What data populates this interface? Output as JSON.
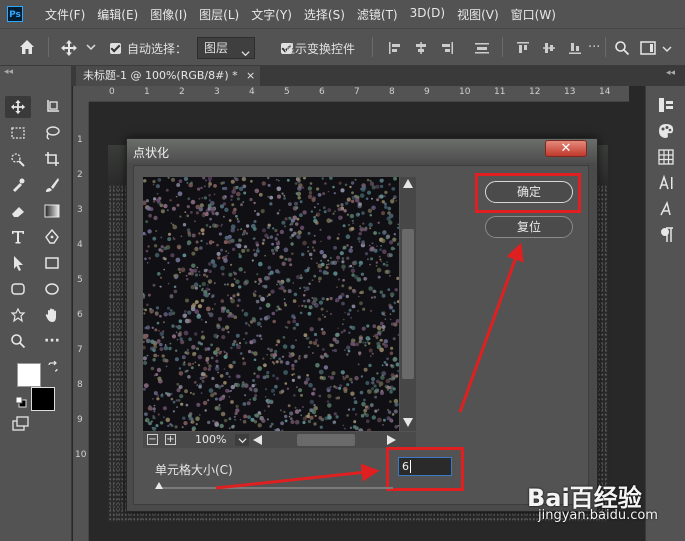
{
  "app": {
    "logo": "Ps"
  },
  "menu": [
    "文件(F)",
    "编辑(E)",
    "图像(I)",
    "图层(L)",
    "文字(Y)",
    "选择(S)",
    "滤镜(T)",
    "3D(D)",
    "视图(V)",
    "窗口(W)"
  ],
  "options_bar": {
    "auto_select_label": "自动选择：",
    "auto_select_value": "图层",
    "show_transform_label": "显示变换控件",
    "auto_select_checked": true,
    "show_transform_checked": true
  },
  "document_tab": {
    "title": "未标题-1 @ 100%(RGB/8#) *",
    "close": "×"
  },
  "panel_collapse": "◂◂",
  "rulers": {
    "top": [
      "0",
      "1",
      "2",
      "3",
      "4",
      "5",
      "6",
      "7",
      "8",
      "9",
      "10",
      "11",
      "12",
      "13",
      "14"
    ],
    "left": [
      "1",
      "2",
      "3",
      "4",
      "5",
      "6",
      "7",
      "8",
      "9",
      "10"
    ]
  },
  "dialog": {
    "title": "点状化",
    "close_label": "✕",
    "ok_label": "确定",
    "reset_label": "复位",
    "zoom_value": "100%",
    "cell_size_label": "单元格大小(C)",
    "cell_size_value": "6",
    "zoom_out": "−",
    "zoom_in": "+",
    "slider_level_fraction": 0.0
  },
  "watermark": {
    "logo": "Bai百经验",
    "url": "jingyan.baidu.com"
  },
  "colors": {
    "accent_red": "#e02020",
    "panel_bg": "#535353",
    "dialog_bg": "#4a4a4a",
    "input_border": "#3a78c8",
    "close_button": "#c0392b"
  }
}
